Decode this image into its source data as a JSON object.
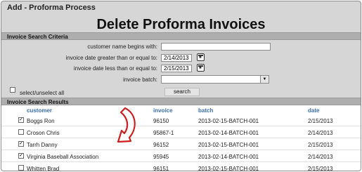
{
  "window": {
    "title": "Add - Proforma Process"
  },
  "page": {
    "title": "Delete Proforma Invoices"
  },
  "criteria": {
    "section_title": "Invoice Search Criteria",
    "customer_label": "customer name begins with:",
    "customer_value": "",
    "date_ge_label": "invoice date greater than or equal to:",
    "date_ge_value": "2/14/2013",
    "date_le_label": "invoice date less than or equal to:",
    "date_le_value": "2/15/2013",
    "batch_label": "invoice batch:",
    "batch_value": "",
    "select_all_label": "select/unselect all",
    "search_label": "search"
  },
  "results": {
    "section_title": "Invoice Search Results",
    "headers": {
      "customer": "customer",
      "invoice": "invoice",
      "batch": "batch",
      "date": "date"
    },
    "rows": [
      {
        "checked": true,
        "customer": "Boggs Ron",
        "invoice": "96150",
        "batch": "2013-02-15-BATCH-001",
        "date": "2/15/2013"
      },
      {
        "checked": false,
        "customer": "Croson Chris",
        "invoice": "95867-1",
        "batch": "2013-02-14-BATCH-001",
        "date": "2/14/2013"
      },
      {
        "checked": true,
        "customer": "Tarrh Danny",
        "invoice": "96152",
        "batch": "2013-02-15-BATCH-001",
        "date": "2/15/2013"
      },
      {
        "checked": true,
        "customer": "Virginia Baseball Association",
        "invoice": "95945",
        "batch": "2013-02-14-BATCH-001",
        "date": "2/14/2013"
      },
      {
        "checked": false,
        "customer": "Whitten Brad",
        "invoice": "96151",
        "batch": "2013-02-15-BATCH-001",
        "date": "2/15/2013"
      }
    ]
  },
  "colors": {
    "header_link": "#3b6fb0",
    "arrow_fill": "#ffffff",
    "arrow_stroke": "#cc1f1f",
    "panel": "#d6d6d6"
  },
  "icons": {
    "calendar": "calendar-icon",
    "dropdown": "chevron-down-icon",
    "annotation": "curved-arrow-icon"
  }
}
